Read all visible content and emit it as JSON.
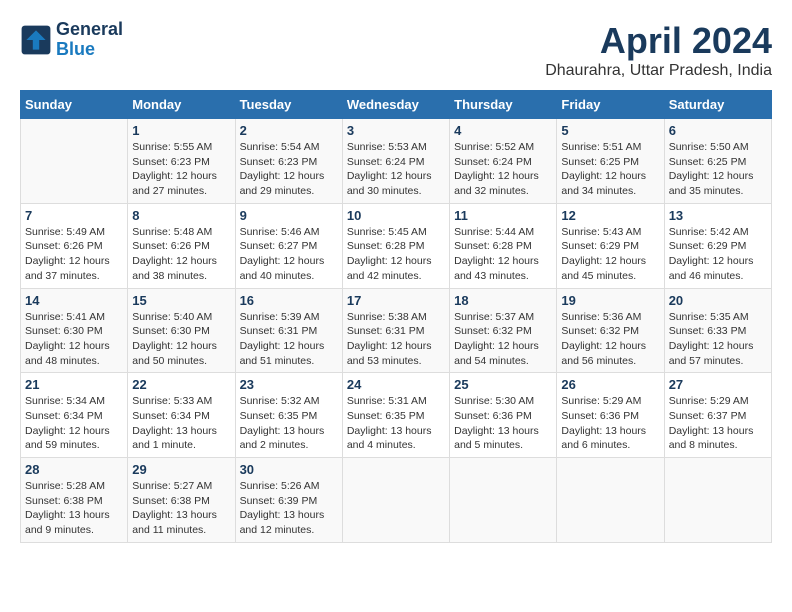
{
  "header": {
    "logo_line1": "General",
    "logo_line2": "Blue",
    "title": "April 2024",
    "subtitle": "Dhaurahra, Uttar Pradesh, India"
  },
  "columns": [
    "Sunday",
    "Monday",
    "Tuesday",
    "Wednesday",
    "Thursday",
    "Friday",
    "Saturday"
  ],
  "weeks": [
    [
      {
        "day": "",
        "info": ""
      },
      {
        "day": "1",
        "info": "Sunrise: 5:55 AM\nSunset: 6:23 PM\nDaylight: 12 hours\nand 27 minutes."
      },
      {
        "day": "2",
        "info": "Sunrise: 5:54 AM\nSunset: 6:23 PM\nDaylight: 12 hours\nand 29 minutes."
      },
      {
        "day": "3",
        "info": "Sunrise: 5:53 AM\nSunset: 6:24 PM\nDaylight: 12 hours\nand 30 minutes."
      },
      {
        "day": "4",
        "info": "Sunrise: 5:52 AM\nSunset: 6:24 PM\nDaylight: 12 hours\nand 32 minutes."
      },
      {
        "day": "5",
        "info": "Sunrise: 5:51 AM\nSunset: 6:25 PM\nDaylight: 12 hours\nand 34 minutes."
      },
      {
        "day": "6",
        "info": "Sunrise: 5:50 AM\nSunset: 6:25 PM\nDaylight: 12 hours\nand 35 minutes."
      }
    ],
    [
      {
        "day": "7",
        "info": "Sunrise: 5:49 AM\nSunset: 6:26 PM\nDaylight: 12 hours\nand 37 minutes."
      },
      {
        "day": "8",
        "info": "Sunrise: 5:48 AM\nSunset: 6:26 PM\nDaylight: 12 hours\nand 38 minutes."
      },
      {
        "day": "9",
        "info": "Sunrise: 5:46 AM\nSunset: 6:27 PM\nDaylight: 12 hours\nand 40 minutes."
      },
      {
        "day": "10",
        "info": "Sunrise: 5:45 AM\nSunset: 6:28 PM\nDaylight: 12 hours\nand 42 minutes."
      },
      {
        "day": "11",
        "info": "Sunrise: 5:44 AM\nSunset: 6:28 PM\nDaylight: 12 hours\nand 43 minutes."
      },
      {
        "day": "12",
        "info": "Sunrise: 5:43 AM\nSunset: 6:29 PM\nDaylight: 12 hours\nand 45 minutes."
      },
      {
        "day": "13",
        "info": "Sunrise: 5:42 AM\nSunset: 6:29 PM\nDaylight: 12 hours\nand 46 minutes."
      }
    ],
    [
      {
        "day": "14",
        "info": "Sunrise: 5:41 AM\nSunset: 6:30 PM\nDaylight: 12 hours\nand 48 minutes."
      },
      {
        "day": "15",
        "info": "Sunrise: 5:40 AM\nSunset: 6:30 PM\nDaylight: 12 hours\nand 50 minutes."
      },
      {
        "day": "16",
        "info": "Sunrise: 5:39 AM\nSunset: 6:31 PM\nDaylight: 12 hours\nand 51 minutes."
      },
      {
        "day": "17",
        "info": "Sunrise: 5:38 AM\nSunset: 6:31 PM\nDaylight: 12 hours\nand 53 minutes."
      },
      {
        "day": "18",
        "info": "Sunrise: 5:37 AM\nSunset: 6:32 PM\nDaylight: 12 hours\nand 54 minutes."
      },
      {
        "day": "19",
        "info": "Sunrise: 5:36 AM\nSunset: 6:32 PM\nDaylight: 12 hours\nand 56 minutes."
      },
      {
        "day": "20",
        "info": "Sunrise: 5:35 AM\nSunset: 6:33 PM\nDaylight: 12 hours\nand 57 minutes."
      }
    ],
    [
      {
        "day": "21",
        "info": "Sunrise: 5:34 AM\nSunset: 6:34 PM\nDaylight: 12 hours\nand 59 minutes."
      },
      {
        "day": "22",
        "info": "Sunrise: 5:33 AM\nSunset: 6:34 PM\nDaylight: 13 hours\nand 1 minute."
      },
      {
        "day": "23",
        "info": "Sunrise: 5:32 AM\nSunset: 6:35 PM\nDaylight: 13 hours\nand 2 minutes."
      },
      {
        "day": "24",
        "info": "Sunrise: 5:31 AM\nSunset: 6:35 PM\nDaylight: 13 hours\nand 4 minutes."
      },
      {
        "day": "25",
        "info": "Sunrise: 5:30 AM\nSunset: 6:36 PM\nDaylight: 13 hours\nand 5 minutes."
      },
      {
        "day": "26",
        "info": "Sunrise: 5:29 AM\nSunset: 6:36 PM\nDaylight: 13 hours\nand 6 minutes."
      },
      {
        "day": "27",
        "info": "Sunrise: 5:29 AM\nSunset: 6:37 PM\nDaylight: 13 hours\nand 8 minutes."
      }
    ],
    [
      {
        "day": "28",
        "info": "Sunrise: 5:28 AM\nSunset: 6:38 PM\nDaylight: 13 hours\nand 9 minutes."
      },
      {
        "day": "29",
        "info": "Sunrise: 5:27 AM\nSunset: 6:38 PM\nDaylight: 13 hours\nand 11 minutes."
      },
      {
        "day": "30",
        "info": "Sunrise: 5:26 AM\nSunset: 6:39 PM\nDaylight: 13 hours\nand 12 minutes."
      },
      {
        "day": "",
        "info": ""
      },
      {
        "day": "",
        "info": ""
      },
      {
        "day": "",
        "info": ""
      },
      {
        "day": "",
        "info": ""
      }
    ]
  ]
}
